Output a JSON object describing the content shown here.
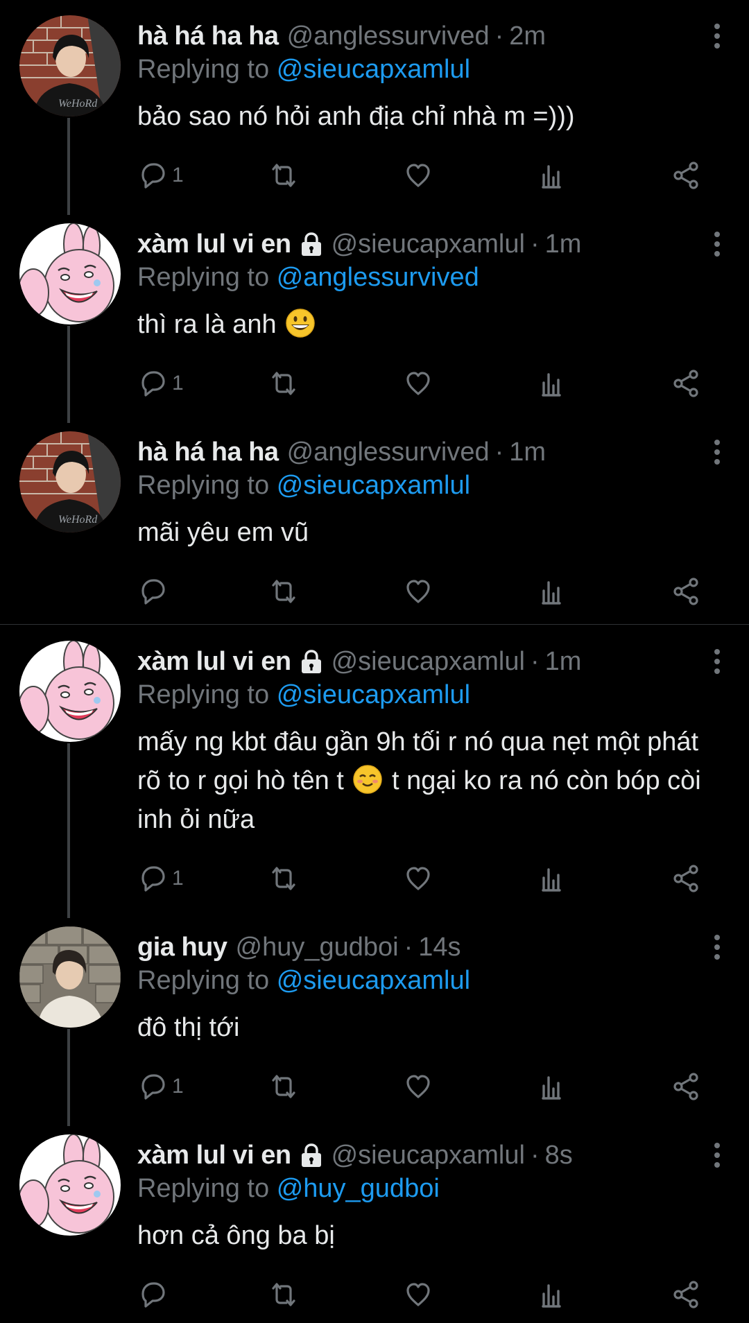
{
  "tweets": [
    {
      "display_name": "hà há ha ha",
      "handle": "@anglessurvived",
      "time": "2m",
      "replying_prefix": "Replying to",
      "replying_to": "@sieucapxamlul",
      "text": "bảo sao nó hỏi anh địa chỉ nhà m =)))",
      "reply_count": "1",
      "avatar": "photo-boy-brick-wall",
      "locked": false
    },
    {
      "display_name": "xàm lul vi en",
      "handle": "@sieucapxamlul",
      "time": "1m",
      "replying_prefix": "Replying to",
      "replying_to": "@anglessurvived",
      "text": "thì ra là anh",
      "emoji": "grinning-face",
      "reply_count": "1",
      "avatar": "pink-bunny-cartoon",
      "locked": true
    },
    {
      "display_name": "hà há ha ha",
      "handle": "@anglessurvived",
      "time": "1m",
      "replying_prefix": "Replying to",
      "replying_to": "@sieucapxamlul",
      "text": "mãi yêu em vũ",
      "reply_count": "",
      "avatar": "photo-boy-brick-wall",
      "locked": false
    },
    {
      "display_name": "xàm lul vi en",
      "handle": "@sieucapxamlul",
      "time": "1m",
      "replying_prefix": "Replying to",
      "replying_to": "@sieucapxamlul",
      "text_line1": "mấy ng kbt đâu gần 9h tối r nó qua nẹt một phát",
      "text_line2a": "rõ to r gọi hò tên t",
      "text_line2b": "t ngại ko ra nó còn bóp còi",
      "text_line3": "inh ỏi nữa",
      "emoji": "smiling-face",
      "reply_count": "1",
      "avatar": "pink-bunny-cartoon",
      "locked": true
    },
    {
      "display_name": "gia huy",
      "handle": "@huy_gudboi",
      "time": "14s",
      "replying_prefix": "Replying to",
      "replying_to": "@sieucapxamlul",
      "text": "đô thị tới",
      "reply_count": "1",
      "avatar": "photo-boy-stone-wall",
      "locked": false
    },
    {
      "display_name": "xàm lul vi en",
      "handle": "@sieucapxamlul",
      "time": "8s",
      "replying_prefix": "Replying to",
      "replying_to": "@huy_gudboi",
      "text": "hơn cả ông ba bị",
      "reply_count": "",
      "avatar": "pink-bunny-cartoon",
      "locked": true
    }
  ],
  "icons": {
    "reply": "reply-bubble-icon",
    "retweet": "retweet-icon",
    "like": "heart-icon",
    "views": "analytics-bars-icon",
    "share": "share-icon",
    "more": "more-vertical-icon",
    "lock": "lock-icon"
  },
  "colors": {
    "background": "#000000",
    "text": "#e7e9ea",
    "muted": "#71767b",
    "link": "#1d9bf0",
    "thread_line": "#3e4144"
  }
}
